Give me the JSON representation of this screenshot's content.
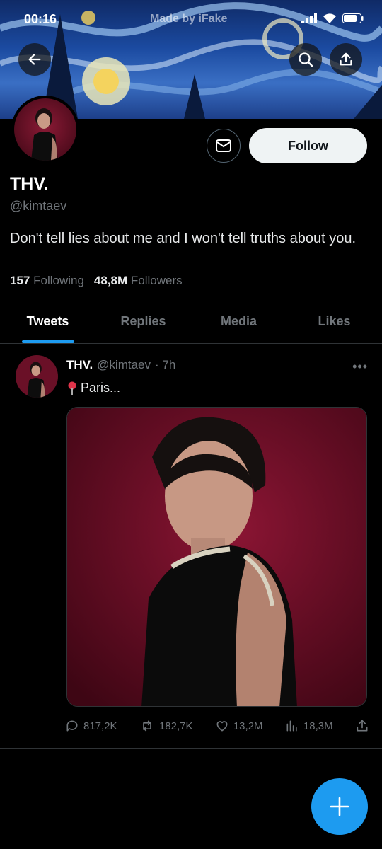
{
  "status_bar": {
    "time": "00:16",
    "overlay_text": "Made by iFake"
  },
  "header": {
    "back_icon": "arrow-left-icon",
    "search_icon": "search-icon",
    "share_icon": "share-icon"
  },
  "profile": {
    "display_name": "THV.",
    "handle": "@kimtaev",
    "bio": "Don't tell lies about me and I won't tell truths about you.",
    "following_count": "157",
    "following_label": "Following",
    "followers_count": "48,8M",
    "followers_label": "Followers",
    "follow_label": "Follow"
  },
  "tabs": [
    {
      "label": "Tweets",
      "active": true
    },
    {
      "label": "Replies",
      "active": false
    },
    {
      "label": "Media",
      "active": false
    },
    {
      "label": "Likes",
      "active": false
    }
  ],
  "tweet": {
    "name": "THV.",
    "handle": "@kimtaev",
    "time": "· 7h",
    "text": "Paris...",
    "replies": "817,2K",
    "retweets": "182,7K",
    "likes": "13,2M",
    "views": "18,3M"
  },
  "colors": {
    "accent": "#1d9bf0",
    "background": "#000000",
    "muted": "#71767b"
  }
}
